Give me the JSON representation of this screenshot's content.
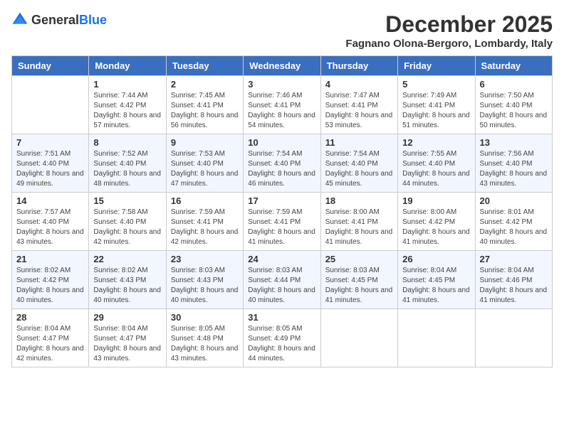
{
  "header": {
    "logo_general": "General",
    "logo_blue": "Blue",
    "month_title": "December 2025",
    "location": "Fagnano Olona-Bergoro, Lombardy, Italy"
  },
  "columns": [
    "Sunday",
    "Monday",
    "Tuesday",
    "Wednesday",
    "Thursday",
    "Friday",
    "Saturday"
  ],
  "weeks": [
    [
      {
        "day": "",
        "sunrise": "",
        "sunset": "",
        "daylight": ""
      },
      {
        "day": "1",
        "sunrise": "Sunrise: 7:44 AM",
        "sunset": "Sunset: 4:42 PM",
        "daylight": "Daylight: 8 hours and 57 minutes."
      },
      {
        "day": "2",
        "sunrise": "Sunrise: 7:45 AM",
        "sunset": "Sunset: 4:41 PM",
        "daylight": "Daylight: 8 hours and 56 minutes."
      },
      {
        "day": "3",
        "sunrise": "Sunrise: 7:46 AM",
        "sunset": "Sunset: 4:41 PM",
        "daylight": "Daylight: 8 hours and 54 minutes."
      },
      {
        "day": "4",
        "sunrise": "Sunrise: 7:47 AM",
        "sunset": "Sunset: 4:41 PM",
        "daylight": "Daylight: 8 hours and 53 minutes."
      },
      {
        "day": "5",
        "sunrise": "Sunrise: 7:49 AM",
        "sunset": "Sunset: 4:41 PM",
        "daylight": "Daylight: 8 hours and 51 minutes."
      },
      {
        "day": "6",
        "sunrise": "Sunrise: 7:50 AM",
        "sunset": "Sunset: 4:40 PM",
        "daylight": "Daylight: 8 hours and 50 minutes."
      }
    ],
    [
      {
        "day": "7",
        "sunrise": "Sunrise: 7:51 AM",
        "sunset": "Sunset: 4:40 PM",
        "daylight": "Daylight: 8 hours and 49 minutes."
      },
      {
        "day": "8",
        "sunrise": "Sunrise: 7:52 AM",
        "sunset": "Sunset: 4:40 PM",
        "daylight": "Daylight: 8 hours and 48 minutes."
      },
      {
        "day": "9",
        "sunrise": "Sunrise: 7:53 AM",
        "sunset": "Sunset: 4:40 PM",
        "daylight": "Daylight: 8 hours and 47 minutes."
      },
      {
        "day": "10",
        "sunrise": "Sunrise: 7:54 AM",
        "sunset": "Sunset: 4:40 PM",
        "daylight": "Daylight: 8 hours and 46 minutes."
      },
      {
        "day": "11",
        "sunrise": "Sunrise: 7:54 AM",
        "sunset": "Sunset: 4:40 PM",
        "daylight": "Daylight: 8 hours and 45 minutes."
      },
      {
        "day": "12",
        "sunrise": "Sunrise: 7:55 AM",
        "sunset": "Sunset: 4:40 PM",
        "daylight": "Daylight: 8 hours and 44 minutes."
      },
      {
        "day": "13",
        "sunrise": "Sunrise: 7:56 AM",
        "sunset": "Sunset: 4:40 PM",
        "daylight": "Daylight: 8 hours and 43 minutes."
      }
    ],
    [
      {
        "day": "14",
        "sunrise": "Sunrise: 7:57 AM",
        "sunset": "Sunset: 4:40 PM",
        "daylight": "Daylight: 8 hours and 43 minutes."
      },
      {
        "day": "15",
        "sunrise": "Sunrise: 7:58 AM",
        "sunset": "Sunset: 4:40 PM",
        "daylight": "Daylight: 8 hours and 42 minutes."
      },
      {
        "day": "16",
        "sunrise": "Sunrise: 7:59 AM",
        "sunset": "Sunset: 4:41 PM",
        "daylight": "Daylight: 8 hours and 42 minutes."
      },
      {
        "day": "17",
        "sunrise": "Sunrise: 7:59 AM",
        "sunset": "Sunset: 4:41 PM",
        "daylight": "Daylight: 8 hours and 41 minutes."
      },
      {
        "day": "18",
        "sunrise": "Sunrise: 8:00 AM",
        "sunset": "Sunset: 4:41 PM",
        "daylight": "Daylight: 8 hours and 41 minutes."
      },
      {
        "day": "19",
        "sunrise": "Sunrise: 8:00 AM",
        "sunset": "Sunset: 4:42 PM",
        "daylight": "Daylight: 8 hours and 41 minutes."
      },
      {
        "day": "20",
        "sunrise": "Sunrise: 8:01 AM",
        "sunset": "Sunset: 4:42 PM",
        "daylight": "Daylight: 8 hours and 40 minutes."
      }
    ],
    [
      {
        "day": "21",
        "sunrise": "Sunrise: 8:02 AM",
        "sunset": "Sunset: 4:42 PM",
        "daylight": "Daylight: 8 hours and 40 minutes."
      },
      {
        "day": "22",
        "sunrise": "Sunrise: 8:02 AM",
        "sunset": "Sunset: 4:43 PM",
        "daylight": "Daylight: 8 hours and 40 minutes."
      },
      {
        "day": "23",
        "sunrise": "Sunrise: 8:03 AM",
        "sunset": "Sunset: 4:43 PM",
        "daylight": "Daylight: 8 hours and 40 minutes."
      },
      {
        "day": "24",
        "sunrise": "Sunrise: 8:03 AM",
        "sunset": "Sunset: 4:44 PM",
        "daylight": "Daylight: 8 hours and 40 minutes."
      },
      {
        "day": "25",
        "sunrise": "Sunrise: 8:03 AM",
        "sunset": "Sunset: 4:45 PM",
        "daylight": "Daylight: 8 hours and 41 minutes."
      },
      {
        "day": "26",
        "sunrise": "Sunrise: 8:04 AM",
        "sunset": "Sunset: 4:45 PM",
        "daylight": "Daylight: 8 hours and 41 minutes."
      },
      {
        "day": "27",
        "sunrise": "Sunrise: 8:04 AM",
        "sunset": "Sunset: 4:46 PM",
        "daylight": "Daylight: 8 hours and 41 minutes."
      }
    ],
    [
      {
        "day": "28",
        "sunrise": "Sunrise: 8:04 AM",
        "sunset": "Sunset: 4:47 PM",
        "daylight": "Daylight: 8 hours and 42 minutes."
      },
      {
        "day": "29",
        "sunrise": "Sunrise: 8:04 AM",
        "sunset": "Sunset: 4:47 PM",
        "daylight": "Daylight: 8 hours and 43 minutes."
      },
      {
        "day": "30",
        "sunrise": "Sunrise: 8:05 AM",
        "sunset": "Sunset: 4:48 PM",
        "daylight": "Daylight: 8 hours and 43 minutes."
      },
      {
        "day": "31",
        "sunrise": "Sunrise: 8:05 AM",
        "sunset": "Sunset: 4:49 PM",
        "daylight": "Daylight: 8 hours and 44 minutes."
      },
      {
        "day": "",
        "sunrise": "",
        "sunset": "",
        "daylight": ""
      },
      {
        "day": "",
        "sunrise": "",
        "sunset": "",
        "daylight": ""
      },
      {
        "day": "",
        "sunrise": "",
        "sunset": "",
        "daylight": ""
      }
    ]
  ]
}
